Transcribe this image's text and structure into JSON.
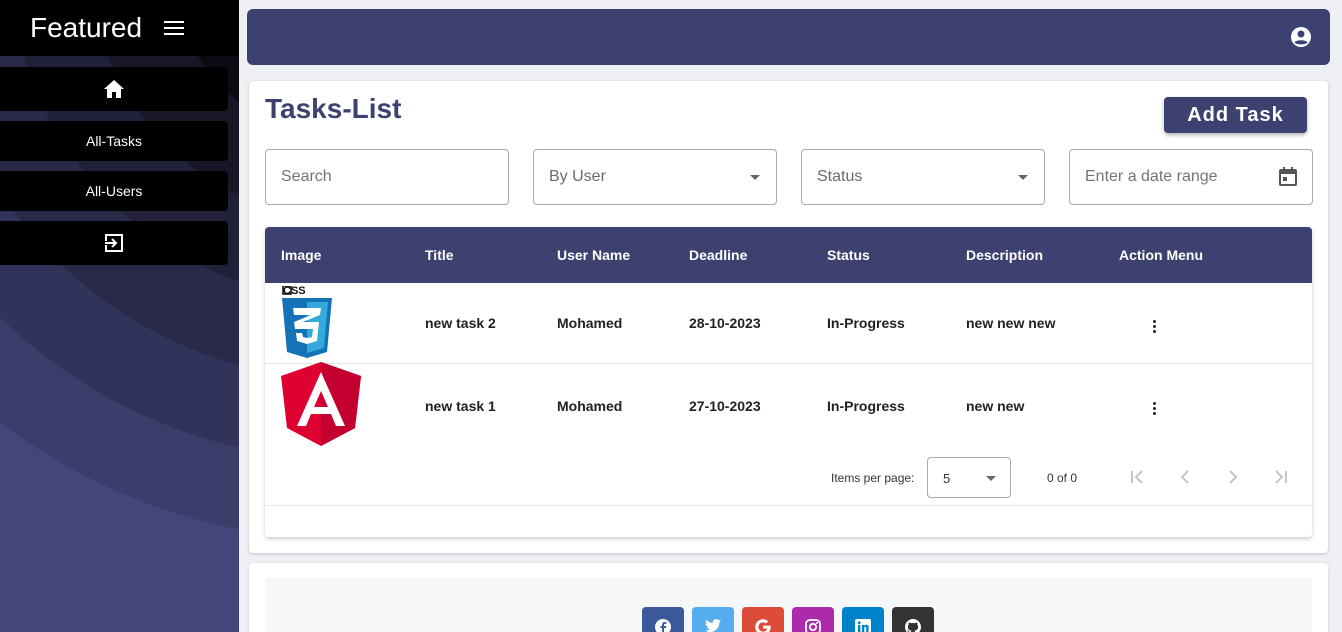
{
  "sidebar": {
    "brand": "Featured",
    "items": [
      {
        "icon": "home-icon"
      },
      {
        "label": "All-Tasks"
      },
      {
        "label": "All-Users"
      },
      {
        "icon": "logout-icon"
      }
    ]
  },
  "header": {
    "title": "Tasks-List",
    "add_label": "Add Task"
  },
  "filters": {
    "search_placeholder": "Search",
    "user_label": "By User",
    "status_label": "Status",
    "date_placeholder": "Enter a date range"
  },
  "table": {
    "columns": [
      "Image",
      "Title",
      "User Name",
      "Deadline",
      "Status",
      "Description",
      "Action Menu"
    ],
    "rows": [
      {
        "image": "css3-logo",
        "title": "new task 2",
        "user": "Mohamed",
        "deadline": "28-10-2023",
        "status": "In-Progress",
        "description": "new new new"
      },
      {
        "image": "angular-logo",
        "title": "new task 1",
        "user": "Mohamed",
        "deadline": "27-10-2023",
        "status": "In-Progress",
        "description": "new new"
      }
    ]
  },
  "paginator": {
    "label": "Items per page:",
    "page_size": "5",
    "range": "0 of 0"
  },
  "footer": {
    "socials": [
      {
        "icon": "facebook-icon",
        "color": "#3b5998"
      },
      {
        "icon": "twitter-icon",
        "color": "#55acee"
      },
      {
        "icon": "google-icon",
        "color": "#dd4b39"
      },
      {
        "icon": "instagram-icon",
        "color": "#ac2bac"
      },
      {
        "icon": "linkedin-icon",
        "color": "#0082ca"
      },
      {
        "icon": "github-icon",
        "color": "#333333"
      }
    ]
  },
  "colors": {
    "primary": "#3d4170",
    "sidebar_bar": "#000000"
  }
}
